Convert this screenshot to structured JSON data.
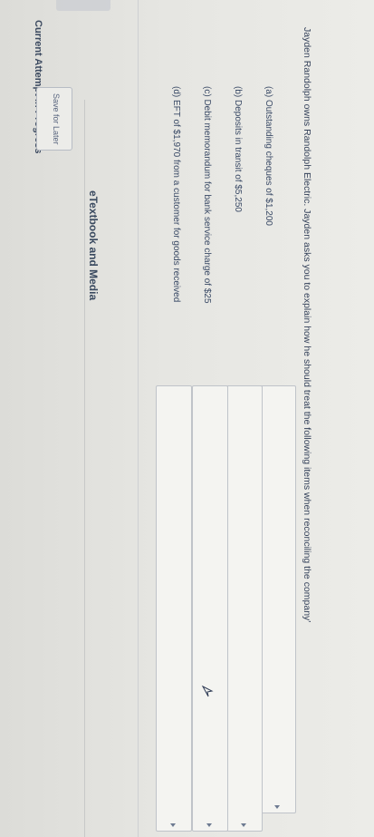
{
  "status": "Current Attempt in Progress",
  "question": "Jayden Randolph owns Randolph Electric. Jayden asks you to explain how he should treat the following items when reconciling the company’",
  "items": [
    "(a)  Outstanding cheques of $1,200",
    "(b)  Deposits in transit of $5,250",
    "(c)  Debit memorandum for bank service charge of $25",
    "(d)  EFT of $1,970 from a customer for goods received"
  ],
  "etextbook": "eTextbook and Media",
  "save_label": "Save for Later"
}
